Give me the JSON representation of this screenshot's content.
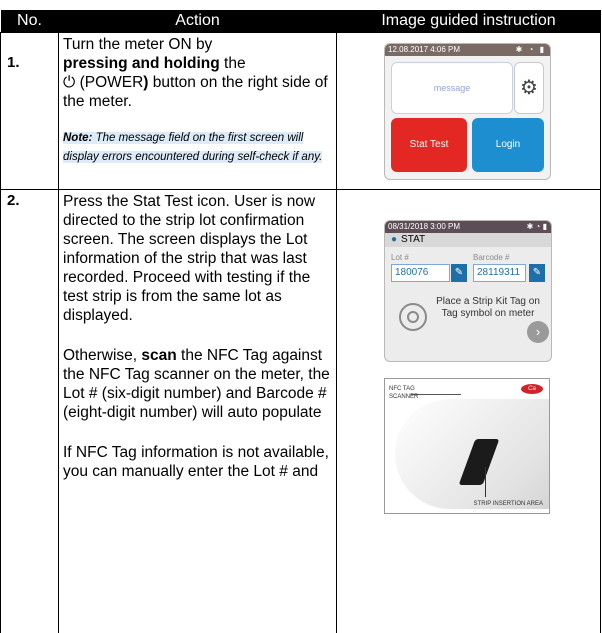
{
  "header": {
    "no": "No.",
    "action": "Action",
    "image": "Image guided instruction"
  },
  "row1": {
    "no": "1.",
    "text_a": "Turn the meter ON by",
    "text_b_bold": "pressing and holding",
    "text_b_rest": " the",
    "power_symbol": "⏻",
    "text_c": " (POWER",
    "text_c_close": ")",
    "text_c_rest": " button on the right side of the meter.",
    "note_label": "Note:",
    "note_text": " The message field on the first screen will display errors encountered during self-check if any.",
    "screen": {
      "status_time": "12.08.2017 4:06 PM",
      "message": "message",
      "gear_icon": "gear-icon",
      "stat_label": "Stat Test",
      "login_label": "Login",
      "stat_color": "#e32823",
      "login_color": "#1d8fd0"
    }
  },
  "row2": {
    "no": "2.",
    "para1": "Press the Stat Test icon. User is now directed to the strip lot confirmation screen. The screen displays the Lot information of the strip that was last recorded. Proceed with testing if the test strip is from the same lot as displayed.",
    "para2_a": "Otherwise, ",
    "para2_bold": "scan",
    "para2_b": " the NFC Tag against the NFC Tag scanner on the meter, the Lot # (six-digit number) and Barcode # (eight-digit number) will auto populate",
    "para3": "If NFC Tag information is not available, you can manually enter the Lot # and",
    "screen": {
      "status_time": "08/31/2018 3:00 PM",
      "title": "STAT",
      "lot_label": "Lot #",
      "lot_value": "180076",
      "barcode_label": "Barcode #",
      "barcode_value": "28119311",
      "message": "Place a Strip Kit Tag on Tag symbol on meter"
    },
    "photo": {
      "label_top": "NFC TAG SCANNER",
      "label_bottom": "STRIP INSERTION AREA"
    }
  }
}
